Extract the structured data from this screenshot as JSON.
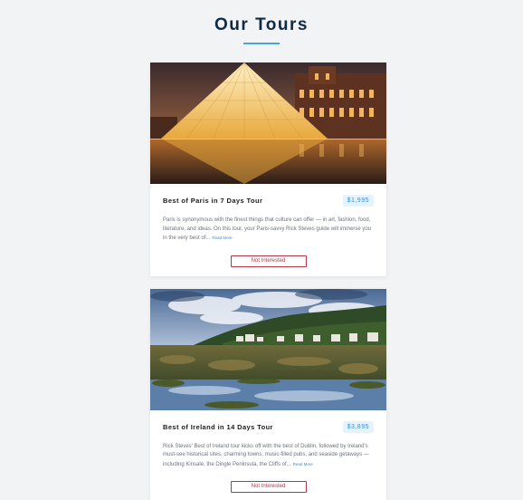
{
  "page": {
    "title": "Our Tours"
  },
  "tours": [
    {
      "title": "Best of Paris in 7 Days Tour",
      "price": "$1,995",
      "description": "Paris is synonymous with the finest things that culture can offer — in art, fashion, food, literature, and ideas. On this tour, your Paris-savvy Rick Steves guide will immerse you in the very best of...",
      "read_more": "Read More",
      "button_label": "Not Interested",
      "image": "louvre-pyramid-night"
    },
    {
      "title": "Best of Ireland in 14 Days Tour",
      "price": "$3,895",
      "description": "Rick Steves' Best of Ireland tour kicks off with the best of Dublin, followed by Ireland's must-see historical sites, charming towns, music-filled pubs, and seaside getaways — including Kinsale, the Dingle Peninsula, the Cliffs of...",
      "read_more": "Read More",
      "button_label": "Not Interested",
      "image": "irish-coast-landscape"
    }
  ],
  "colors": {
    "accent": "#4aa3df",
    "price_text": "#3a8fd1",
    "button_border": "#b23a48",
    "background": "#f1f3f5"
  }
}
